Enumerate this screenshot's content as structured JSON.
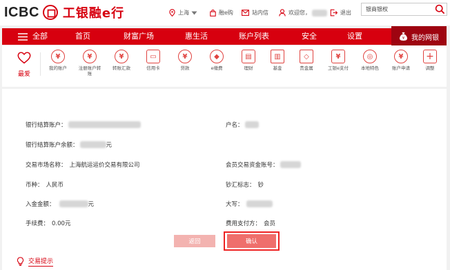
{
  "header": {
    "logo_text": "ICBC",
    "brand_name": "工银融e行",
    "location": "上海",
    "mall": "融e购",
    "messages": "站内信",
    "greeting": "欢迎您，",
    "logout": "退出",
    "search_value": "银商银权"
  },
  "nav": {
    "all": "全部",
    "items": [
      "首页",
      "财富广场",
      "惠生活",
      "账户列表",
      "安全",
      "设置"
    ],
    "my_bank": "我的网银"
  },
  "shortcuts": {
    "favorite": "最爱",
    "items": [
      {
        "label": "我的账户",
        "icon": "¥"
      },
      {
        "label": "注册账户转账",
        "icon": "¥"
      },
      {
        "label": "转账汇款",
        "icon": "¥"
      },
      {
        "label": "信用卡",
        "icon": "▭"
      },
      {
        "label": "贷款",
        "icon": "¥"
      },
      {
        "label": "e缴费",
        "icon": "◆"
      },
      {
        "label": "理财",
        "icon": "▤"
      },
      {
        "label": "基金",
        "icon": "▥"
      },
      {
        "label": "贵金属",
        "icon": "◇"
      },
      {
        "label": "工银e支付",
        "icon": "¥"
      },
      {
        "label": "本地特色",
        "icon": "◎"
      },
      {
        "label": "账户申请",
        "icon": "¥"
      },
      {
        "label": "调整",
        "icon": "+"
      }
    ]
  },
  "form": {
    "settlement_account_label": "银行结算账户：",
    "account_name_label": "户名：",
    "balance_label": "银行结算账户余额：",
    "balance_unit": "元",
    "market_label": "交易市场名称：",
    "market_value": "上海航运运价交易有限公司",
    "member_account_label": "会员交易资金账号：",
    "currency_label": "币种：",
    "currency_value": "人民币",
    "cash_flag_label": "钞汇标志：",
    "cash_flag_value": "钞",
    "amount_label": "入金金额：",
    "amount_unit": "元",
    "capital_label": "大写：",
    "fee_label": "手续费：",
    "fee_value": "0.00元",
    "fee_payer_label": "费用支付方：",
    "fee_payer_value": "会员"
  },
  "buttons": {
    "back": "返回",
    "confirm": "确认"
  },
  "tips": "交易提示",
  "colors": {
    "brand_red": "#d7000f",
    "dark_red": "#9e0410",
    "confirm_red": "#ef6f6c",
    "back_pink": "#f3b3b0"
  }
}
